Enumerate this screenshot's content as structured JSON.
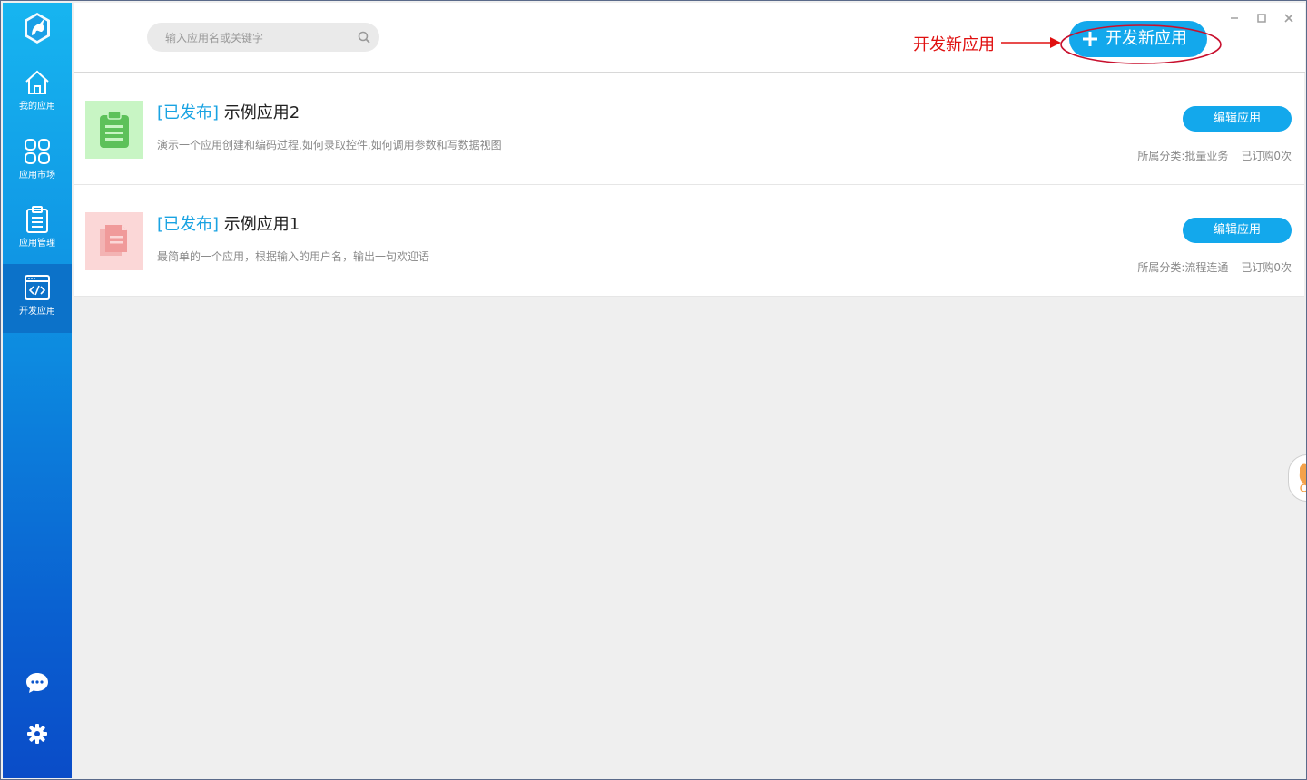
{
  "window": {
    "controls": [
      "minimize-icon",
      "maximize-icon",
      "close-icon"
    ]
  },
  "sidebar": {
    "logo": "unicorn-logo-icon",
    "items": [
      {
        "label": "我的应用",
        "icon": "home-icon",
        "active": false
      },
      {
        "label": "应用市场",
        "icon": "grid-icon",
        "active": false
      },
      {
        "label": "应用管理",
        "icon": "clipboard-icon",
        "active": false
      },
      {
        "label": "开发应用",
        "icon": "code-window-icon",
        "active": true
      }
    ],
    "bottom_icons": [
      "chat-icon",
      "settings-icon"
    ]
  },
  "header": {
    "search_placeholder": "输入应用名或关键字",
    "new_app_label": "开发新应用",
    "annotation_text": "开发新应用"
  },
  "apps": [
    {
      "status": "[已发布]",
      "name": "示例应用2",
      "description": "演示一个应用创建和编码过程,如何录取控件,如何调用参数和写数据视图",
      "category": "所属分类:批量业务",
      "subscriptions": "已订购0次",
      "edit_label": "编辑应用",
      "thumb_color": "#c8f5c4",
      "icon_color": "#5dc15a",
      "icon": "clipboard-icon"
    },
    {
      "status": "[已发布]",
      "name": "示例应用1",
      "description": "最简单的一个应用，根据输入的用户名，输出一句欢迎语",
      "category": "所属分类:流程连通",
      "subscriptions": "已订购0次",
      "edit_label": "编辑应用",
      "thumb_color": "#fbd7d7",
      "icon_color": "#f09a9a",
      "icon": "documents-icon"
    }
  ],
  "colors": {
    "accent": "#13a8ec",
    "annotation": "#e01010"
  }
}
